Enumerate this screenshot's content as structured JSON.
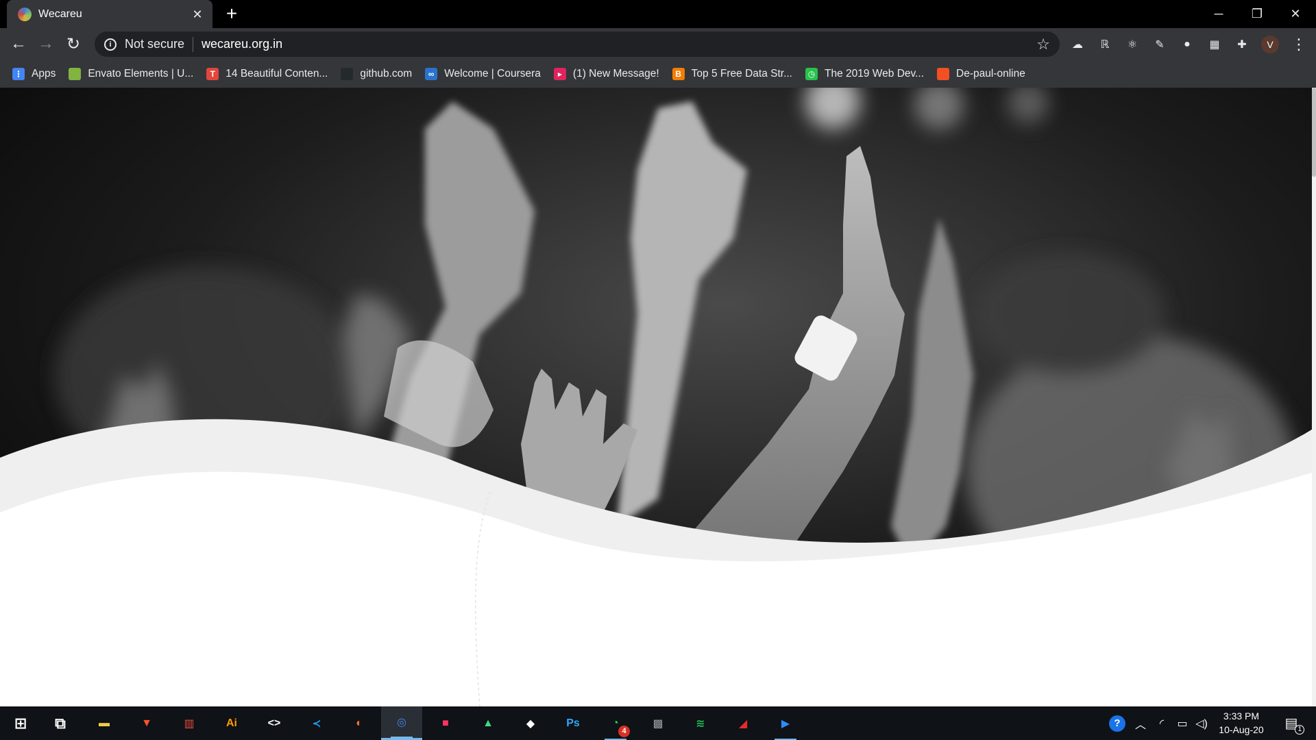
{
  "tab": {
    "title": "Wecareu",
    "close_glyph": "✕",
    "new_tab_glyph": "+"
  },
  "window_controls": {
    "minimize": "─",
    "restore": "❐",
    "close": "✕"
  },
  "toolbar": {
    "back_glyph": "←",
    "forward_glyph": "→",
    "reload_glyph": "↻",
    "security_label": "Not secure",
    "url": "wecareu.org.in",
    "star_glyph": "☆",
    "avatar_letter": "V",
    "menu_glyph": "⋮",
    "extensions": [
      {
        "icon": "cloud-icon",
        "glyph": "☁"
      },
      {
        "icon": "grammar-icon",
        "glyph": "ℝ"
      },
      {
        "icon": "react-devtools-icon",
        "glyph": "⚛"
      },
      {
        "icon": "pen-icon",
        "glyph": "✎"
      },
      {
        "icon": "color-picker-icon",
        "glyph": "●"
      },
      {
        "icon": "chart-icon",
        "glyph": "▦"
      },
      {
        "icon": "puzzle-icon",
        "glyph": "✚"
      }
    ]
  },
  "bookmarks": [
    {
      "label": "Apps",
      "icon": "apps-grid-icon",
      "color": "#4285f4",
      "glyph": "⋮"
    },
    {
      "label": "Envato Elements | U...",
      "icon": "envato-leaf-icon",
      "color": "#82b440",
      "glyph": ""
    },
    {
      "label": "14 Beautiful Conten...",
      "icon": "t-logo-icon",
      "color": "#e2463c",
      "glyph": "T"
    },
    {
      "label": "github.com",
      "icon": "github-icon",
      "color": "#24292e",
      "glyph": ""
    },
    {
      "label": "Welcome | Coursera",
      "icon": "coursera-icon",
      "color": "#2a73cc",
      "glyph": "∞"
    },
    {
      "label": "(1) New Message!",
      "icon": "message-icon",
      "color": "#e0245e",
      "glyph": "▸"
    },
    {
      "label": "Top 5 Free Data Str...",
      "icon": "blogger-icon",
      "color": "#f57d00",
      "glyph": "B"
    },
    {
      "label": "The 2019 Web Dev...",
      "icon": "clock-icon",
      "color": "#27c24c",
      "glyph": "◷"
    },
    {
      "label": "De-paul-online",
      "icon": "microsoft-icon",
      "color": "#f25022",
      "glyph": ""
    }
  ],
  "taskbar": {
    "apps": [
      {
        "icon": "windows-start-icon",
        "color": "#ffffff",
        "glyph": "⊞"
      },
      {
        "icon": "task-view-icon",
        "color": "#ffffff",
        "glyph": "⧉"
      },
      {
        "icon": "file-explorer-icon",
        "color": "#f2c94c",
        "glyph": "▬"
      },
      {
        "icon": "brave-icon",
        "color": "#fb542b",
        "glyph": "▼"
      },
      {
        "icon": "popcorn-icon",
        "color": "#e74c3c",
        "glyph": "▥"
      },
      {
        "icon": "illustrator-icon",
        "color": "#ff9a00",
        "glyph": "Ai"
      },
      {
        "icon": "code-editor-icon",
        "color": "#ffffff",
        "glyph": "<>"
      },
      {
        "icon": "vscode-icon",
        "color": "#1f9cf0",
        "glyph": "≺"
      },
      {
        "icon": "firefox-icon",
        "color": "#ff7139",
        "glyph": "◐"
      },
      {
        "icon": "chrome-icon",
        "color": "#4285f4",
        "glyph": "◎"
      },
      {
        "icon": "notes-icon",
        "color": "#ff3366",
        "glyph": "■"
      },
      {
        "icon": "android-studio-icon",
        "color": "#3ddc84",
        "glyph": "▲"
      },
      {
        "icon": "unity-icon",
        "color": "#ffffff",
        "glyph": "◆"
      },
      {
        "icon": "photoshop-icon",
        "color": "#31a8ff",
        "glyph": "Ps"
      },
      {
        "icon": "whatsapp-icon",
        "color": "#25d366",
        "glyph": "◔",
        "badge": "4"
      },
      {
        "icon": "game-icon",
        "color": "#9aa0a6",
        "glyph": "▩"
      },
      {
        "icon": "spotify-icon",
        "color": "#1db954",
        "glyph": "≋"
      },
      {
        "icon": "sketchup-icon",
        "color": "#e72b2d",
        "glyph": "◢"
      },
      {
        "icon": "zoom-icon",
        "color": "#2d8cff",
        "glyph": "▶"
      }
    ],
    "time": "3:33 PM",
    "date": "10-Aug-20",
    "notification_count": "1"
  }
}
